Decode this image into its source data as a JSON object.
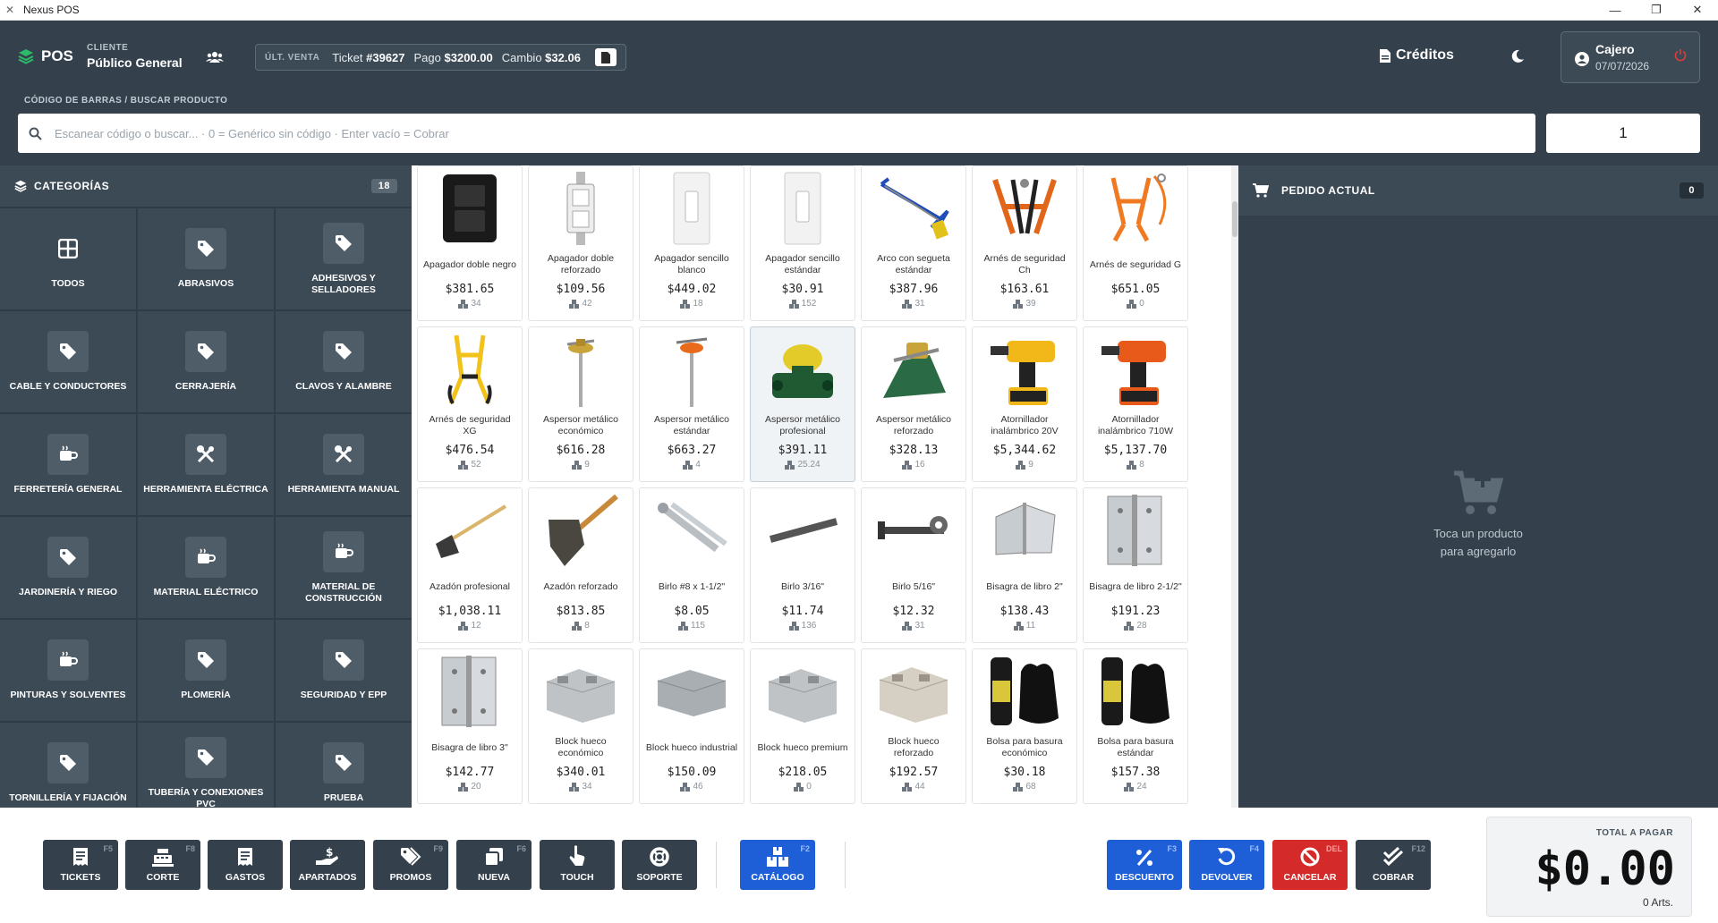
{
  "window": {
    "title": "Nexus POS"
  },
  "header": {
    "logo": "POS",
    "cliente_label": "CLIENTE",
    "cliente_value": "Público General",
    "ultima_venta_label": "ÚLT. VENTA",
    "ticket_label": "Ticket",
    "ticket_value": "#39627",
    "pago_label": "Pago",
    "pago_value": "$3200.00",
    "cambio_label": "Cambio",
    "cambio_value": "$32.06",
    "creditos": "Créditos",
    "cajero_name": "Cajero",
    "cajero_date": "07/07/2026"
  },
  "search": {
    "label": "CÓDIGO DE BARRAS / BUSCAR PRODUCTO",
    "placeholder": "Escanear código o buscar... · 0 = Genérico sin código · Enter vacío = Cobrar",
    "quantity": "1"
  },
  "categories": {
    "title": "CATEGORÍAS",
    "count": "18",
    "items": [
      {
        "label": "TODOS",
        "icon": "grid-icon"
      },
      {
        "label": "ABRASIVOS",
        "icon": "tag-icon"
      },
      {
        "label": "ADHESIVOS Y SELLADORES",
        "icon": "tag-icon"
      },
      {
        "label": "CABLE Y CONDUCTORES",
        "icon": "tag-icon"
      },
      {
        "label": "CERRAJERÍA",
        "icon": "tag-icon"
      },
      {
        "label": "CLAVOS Y ALAMBRE",
        "icon": "tag-icon"
      },
      {
        "label": "FERRETERÍA GENERAL",
        "icon": "mug-icon"
      },
      {
        "label": "HERRAMIENTA ELÉCTRICA",
        "icon": "tools-icon"
      },
      {
        "label": "HERRAMIENTA MANUAL",
        "icon": "tools-icon"
      },
      {
        "label": "JARDINERÍA Y RIEGO",
        "icon": "tag-icon"
      },
      {
        "label": "MATERIAL ELÉCTRICO",
        "icon": "mug-icon"
      },
      {
        "label": "MATERIAL DE CONSTRUCCIÓN",
        "icon": "mug-icon"
      },
      {
        "label": "PINTURAS Y SOLVENTES",
        "icon": "mug-icon"
      },
      {
        "label": "PLOMERÍA",
        "icon": "tag-icon"
      },
      {
        "label": "SEGURIDAD Y EPP",
        "icon": "tag-icon"
      },
      {
        "label": "TORNILLERÍA Y FIJACIÓN",
        "icon": "tag-icon"
      },
      {
        "label": "TUBERÍA Y CONEXIONES PVC",
        "icon": "tag-icon"
      },
      {
        "label": "PRUEBA",
        "icon": "tag-icon"
      }
    ]
  },
  "products": [
    {
      "name": "Apagador doble negro",
      "price": "$381.65",
      "stock": "34",
      "img": "switch-black"
    },
    {
      "name": "Apagador doble reforzado",
      "price": "$109.56",
      "stock": "42",
      "img": "switch-double"
    },
    {
      "name": "Apagador sencillo blanco",
      "price": "$449.02",
      "stock": "18",
      "img": "switch-white"
    },
    {
      "name": "Apagador sencillo estándar",
      "price": "$30.91",
      "stock": "152",
      "img": "switch-white"
    },
    {
      "name": "Arco con segueta estándar",
      "price": "$387.96",
      "stock": "31",
      "img": "hacksaw"
    },
    {
      "name": "Arnés de seguridad Ch",
      "price": "$163.61",
      "stock": "39",
      "img": "harness-orange"
    },
    {
      "name": "Arnés de seguridad G",
      "price": "$651.05",
      "stock": "0",
      "img": "harness-orange2"
    },
    {
      "name": "Arnés de seguridad XG",
      "price": "$476.54",
      "stock": "52",
      "img": "harness-yellow"
    },
    {
      "name": "Aspersor metálico económico",
      "price": "$616.28",
      "stock": "9",
      "img": "sprinkler-yellow"
    },
    {
      "name": "Aspersor metálico estándar",
      "price": "$663.27",
      "stock": "4",
      "img": "sprinkler-orange"
    },
    {
      "name": "Aspersor metálico profesional",
      "price": "$391.11",
      "stock": "25.24",
      "img": "sprinkler-green"
    },
    {
      "name": "Aspersor metálico reforzado",
      "price": "$328.13",
      "stock": "16",
      "img": "sprinkler-green2"
    },
    {
      "name": "Atornillador inalámbrico 20V",
      "price": "$5,344.62",
      "stock": "9",
      "img": "drill-yellow"
    },
    {
      "name": "Atornillador inalámbrico 710W",
      "price": "$5,137.70",
      "stock": "8",
      "img": "drill-orange"
    },
    {
      "name": "Azadón profesional",
      "price": "$1,038.11",
      "stock": "12",
      "img": "hoe"
    },
    {
      "name": "Azadón reforzado",
      "price": "$813.85",
      "stock": "8",
      "img": "hoe2"
    },
    {
      "name": "Birlo #8 x 1-1/2\"",
      "price": "$8.05",
      "stock": "115",
      "img": "bolt"
    },
    {
      "name": "Birlo 3/16\"",
      "price": "$11.74",
      "stock": "136",
      "img": "bolt-dark"
    },
    {
      "name": "Birlo 5/16\"",
      "price": "$12.32",
      "stock": "31",
      "img": "bolt-nut"
    },
    {
      "name": "Bisagra de libro 2\"",
      "price": "$138.43",
      "stock": "11",
      "img": "hinge"
    },
    {
      "name": "Bisagra de libro 2-1/2\"",
      "price": "$191.23",
      "stock": "28",
      "img": "hinge2"
    },
    {
      "name": "Bisagra de libro 3\"",
      "price": "$142.77",
      "stock": "20",
      "img": "hinge2"
    },
    {
      "name": "Block hueco económico",
      "price": "$340.01",
      "stock": "34",
      "img": "block"
    },
    {
      "name": "Block hueco industrial",
      "price": "$150.09",
      "stock": "46",
      "img": "block-solid"
    },
    {
      "name": "Block hueco premium",
      "price": "$218.05",
      "stock": "0",
      "img": "block"
    },
    {
      "name": "Block hueco reforzado",
      "price": "$192.57",
      "stock": "44",
      "img": "block-tan"
    },
    {
      "name": "Bolsa para basura económico",
      "price": "$30.18",
      "stock": "68",
      "img": "trashbag"
    },
    {
      "name": "Bolsa para basura estándar",
      "price": "$157.38",
      "stock": "24",
      "img": "trashbag"
    }
  ],
  "selected_product_index": 10,
  "order": {
    "title": "PEDIDO ACTUAL",
    "count": "0",
    "empty_line1": "Toca un producto",
    "empty_line2": "para agregarlo"
  },
  "footer_buttons": [
    {
      "label": "TICKETS",
      "key": "F5",
      "icon": "receipt-icon",
      "color": "dark"
    },
    {
      "label": "CORTE",
      "key": "F8",
      "icon": "register-icon",
      "color": "dark"
    },
    {
      "label": "GASTOS",
      "key": "",
      "icon": "receipt-icon",
      "color": "dark"
    },
    {
      "label": "APARTADOS",
      "key": "",
      "icon": "hand-money-icon",
      "color": "dark"
    },
    {
      "label": "PROMOS",
      "key": "F9",
      "icon": "tags-icon",
      "color": "dark"
    },
    {
      "label": "NUEVA",
      "key": "F6",
      "icon": "copy-icon",
      "color": "dark"
    },
    {
      "label": "TOUCH",
      "key": "",
      "icon": "pointer-icon",
      "color": "dark"
    },
    {
      "label": "SOPORTE",
      "key": "",
      "icon": "lifebuoy-icon",
      "color": "dark"
    },
    {
      "label": "CATÁLOGO",
      "key": "F2",
      "icon": "boxes-icon",
      "color": "blue"
    },
    {
      "label": "DESCUENTO",
      "key": "F3",
      "icon": "percent-icon",
      "color": "blue"
    },
    {
      "label": "DEVOLVER",
      "key": "F4",
      "icon": "undo-icon",
      "color": "blue"
    },
    {
      "label": "CANCELAR",
      "key": "DEL",
      "icon": "ban-icon",
      "color": "red"
    },
    {
      "label": "COBRAR",
      "key": "F12",
      "icon": "checks-icon",
      "color": "dark"
    }
  ],
  "total": {
    "label": "TOTAL A PAGAR",
    "amount": "$0.00",
    "articles": "0 Arts."
  },
  "colors": {
    "panel": "#34414c",
    "tile": "#3c4a56",
    "blue": "#1e5fd8",
    "red": "#d42a2a"
  }
}
